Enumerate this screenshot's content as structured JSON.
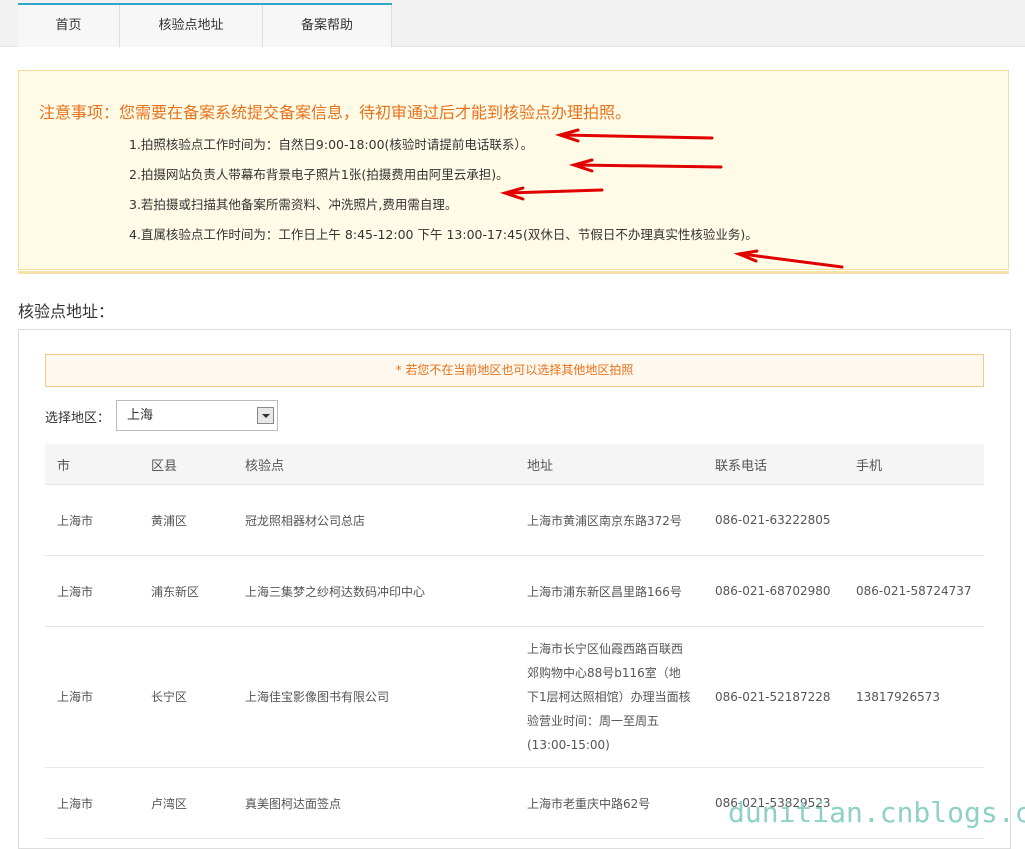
{
  "nav": {
    "tabs": [
      "首页",
      "核验点地址",
      "备案帮助"
    ]
  },
  "notice": {
    "title_label": "注意事项：",
    "title_text": "您需要在备案系统提交备案信息，待初审通过后才能到核验点办理拍照。",
    "items": [
      "1.拍照核验点工作时间为：自然日9:00-18:00(核验时请提前电话联系）。",
      "2.拍摄网站负责人带幕布背景电子照片1张(拍摄费用由阿里云承担)。",
      "3.若拍摄或扫描其他备案所需资料、冲洗照片,费用需自理。",
      "4.直属核验点工作时间为：工作日上午 8:45-12:00 下午 13:00-17:45(双休日、节假日不办理真实性核验业务)。"
    ]
  },
  "section": {
    "title": "核验点地址："
  },
  "tip": {
    "text": "* 若您不在当前地区也可以选择其他地区拍照"
  },
  "region": {
    "label": "选择地区：",
    "selected": "上海"
  },
  "table": {
    "headers": [
      "市",
      "区县",
      "核验点",
      "地址",
      "联系电话",
      "手机"
    ],
    "rows": [
      [
        "上海市",
        "黄浦区",
        "冠龙照相器材公司总店",
        "上海市黄浦区南京东路372号",
        "086-021-63222805",
        ""
      ],
      [
        "上海市",
        "浦东新区",
        "上海三集梦之纱柯达数码冲印中心",
        "上海市浦东新区昌里路166号",
        "086-021-68702980",
        "086-021-58724737"
      ],
      [
        "上海市",
        "长宁区",
        "上海佳宝影像图书有限公司",
        "上海市长宁区仙霞西路百联西郊购物中心88号b116室（地下1层柯达照相馆）办理当面核验营业时间：周一至周五(13:00-15:00)",
        "086-021-52187228",
        "13817926573"
      ],
      [
        "上海市",
        "卢湾区",
        "真美图柯达面签点",
        "上海市老重庆中路62号",
        "086-021-53829523",
        ""
      ]
    ]
  },
  "watermark": {
    "text": "dunitian.cnblogs.com"
  },
  "colors": {
    "accent": "#32a6c9",
    "orange": "#e8711b",
    "arrow": "#e00000"
  }
}
